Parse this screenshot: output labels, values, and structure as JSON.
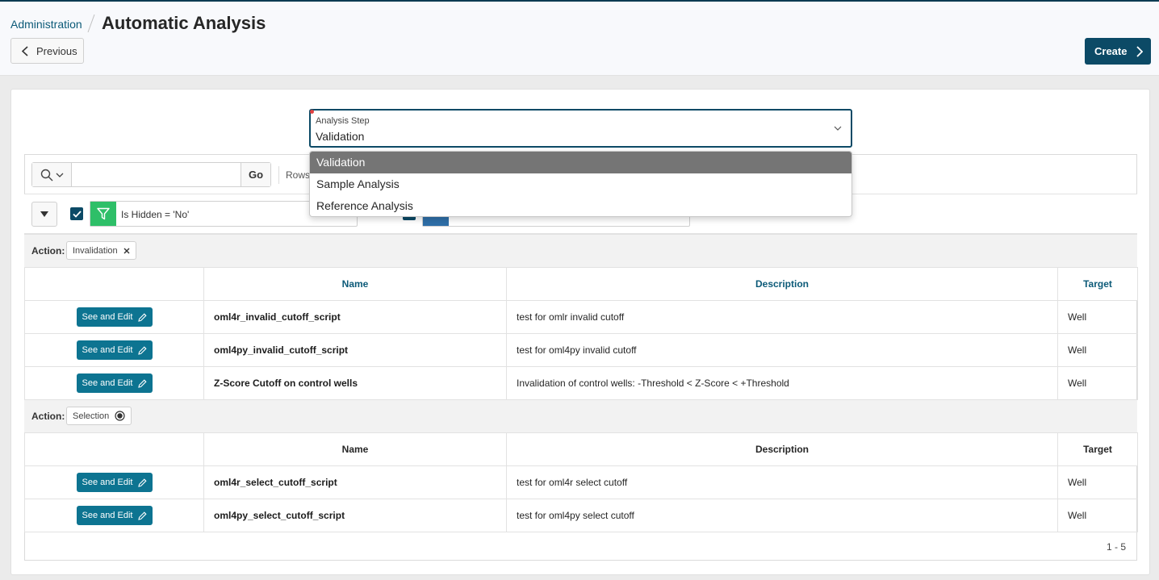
{
  "header": {
    "breadcrumb": "Administration",
    "title": "Automatic Analysis",
    "previous_label": "Previous",
    "create_label": "Create"
  },
  "analysis_step": {
    "label": "Analysis Step",
    "value": "Validation",
    "options": [
      "Validation",
      "Sample Analysis",
      "Reference Analysis"
    ]
  },
  "toolbar": {
    "go_label": "Go",
    "rows_label": "Rows",
    "search_placeholder": ""
  },
  "filters": {
    "filter1": "Is Hidden = 'No'"
  },
  "groups": [
    {
      "label": "Action:",
      "chip": "Invalidation",
      "columns": [
        "Name",
        "Description",
        "Target"
      ],
      "rows": [
        {
          "button": "See and Edit",
          "name": "oml4r_invalid_cutoff_script",
          "description": "test for omlr invalid cutoff",
          "target": "Well"
        },
        {
          "button": "See and Edit",
          "name": "oml4py_invalid_cutoff_script",
          "description": "test for oml4py invalid cutoff",
          "target": "Well"
        },
        {
          "button": "See and Edit",
          "name": "Z-Score Cutoff on control wells",
          "description": "Invalidation of control wells: -Threshold < Z-Score < +Threshold",
          "target": "Well"
        }
      ]
    },
    {
      "label": "Action:",
      "chip": "Selection",
      "columns": [
        "Name",
        "Description",
        "Target"
      ],
      "rows": [
        {
          "button": "See and Edit",
          "name": "oml4r_select_cutoff_script",
          "description": "test for oml4r select cutoff",
          "target": "Well"
        },
        {
          "button": "See and Edit",
          "name": "oml4py_select_cutoff_script",
          "description": "test for oml4py select cutoff",
          "target": "Well"
        }
      ]
    }
  ],
  "pagination": "1 - 5",
  "colors": {
    "primary": "#0c4a66",
    "button_teal": "#0d7491",
    "filter_green": "#2ebf68",
    "link_blue": "#0c5a78"
  }
}
